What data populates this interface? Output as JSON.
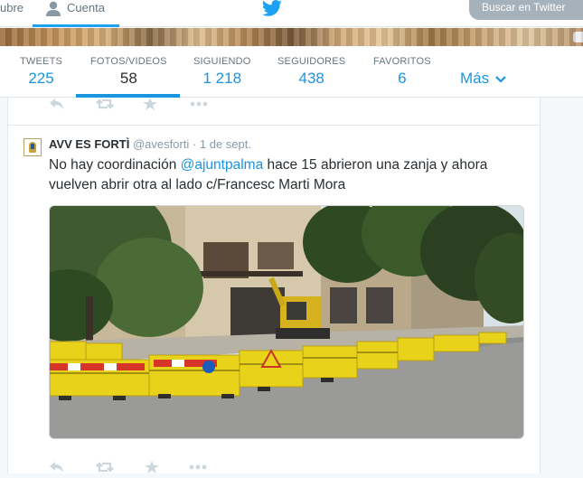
{
  "topnav": {
    "prev_label": "ubre",
    "account_label": "Cuenta",
    "search_label": "Buscar en Twitter"
  },
  "stats": [
    {
      "label": "TWEETS",
      "value": "225"
    },
    {
      "label": "FOTOS/VIDEOS",
      "value": "58"
    },
    {
      "label": "SIGUIENDO",
      "value": "1 218"
    },
    {
      "label": "SEGUIDORES",
      "value": "438"
    },
    {
      "label": "FAVORITOS",
      "value": "6"
    }
  ],
  "more_label": "Más",
  "tweet": {
    "name": "AVV ES FORTÌ",
    "handle": "@avesforti",
    "dot": "·",
    "date": "1 de sept.",
    "text_before": "No  hay coordinación ",
    "mention": "@ajuntpalma",
    "text_after": " hace 15 abrieron una zanja y ahora vuelven abrir otra al lado c/Francesc Marti Mora"
  },
  "colors": {
    "accent": "#1b95e0",
    "muted": "#8899a6",
    "active_tab": "#1b95e0"
  },
  "icons": [
    "user-icon",
    "twitter-bird-icon",
    "chevron-down-icon",
    "reply-icon",
    "retweet-icon",
    "favorite-icon",
    "more-icon"
  ]
}
